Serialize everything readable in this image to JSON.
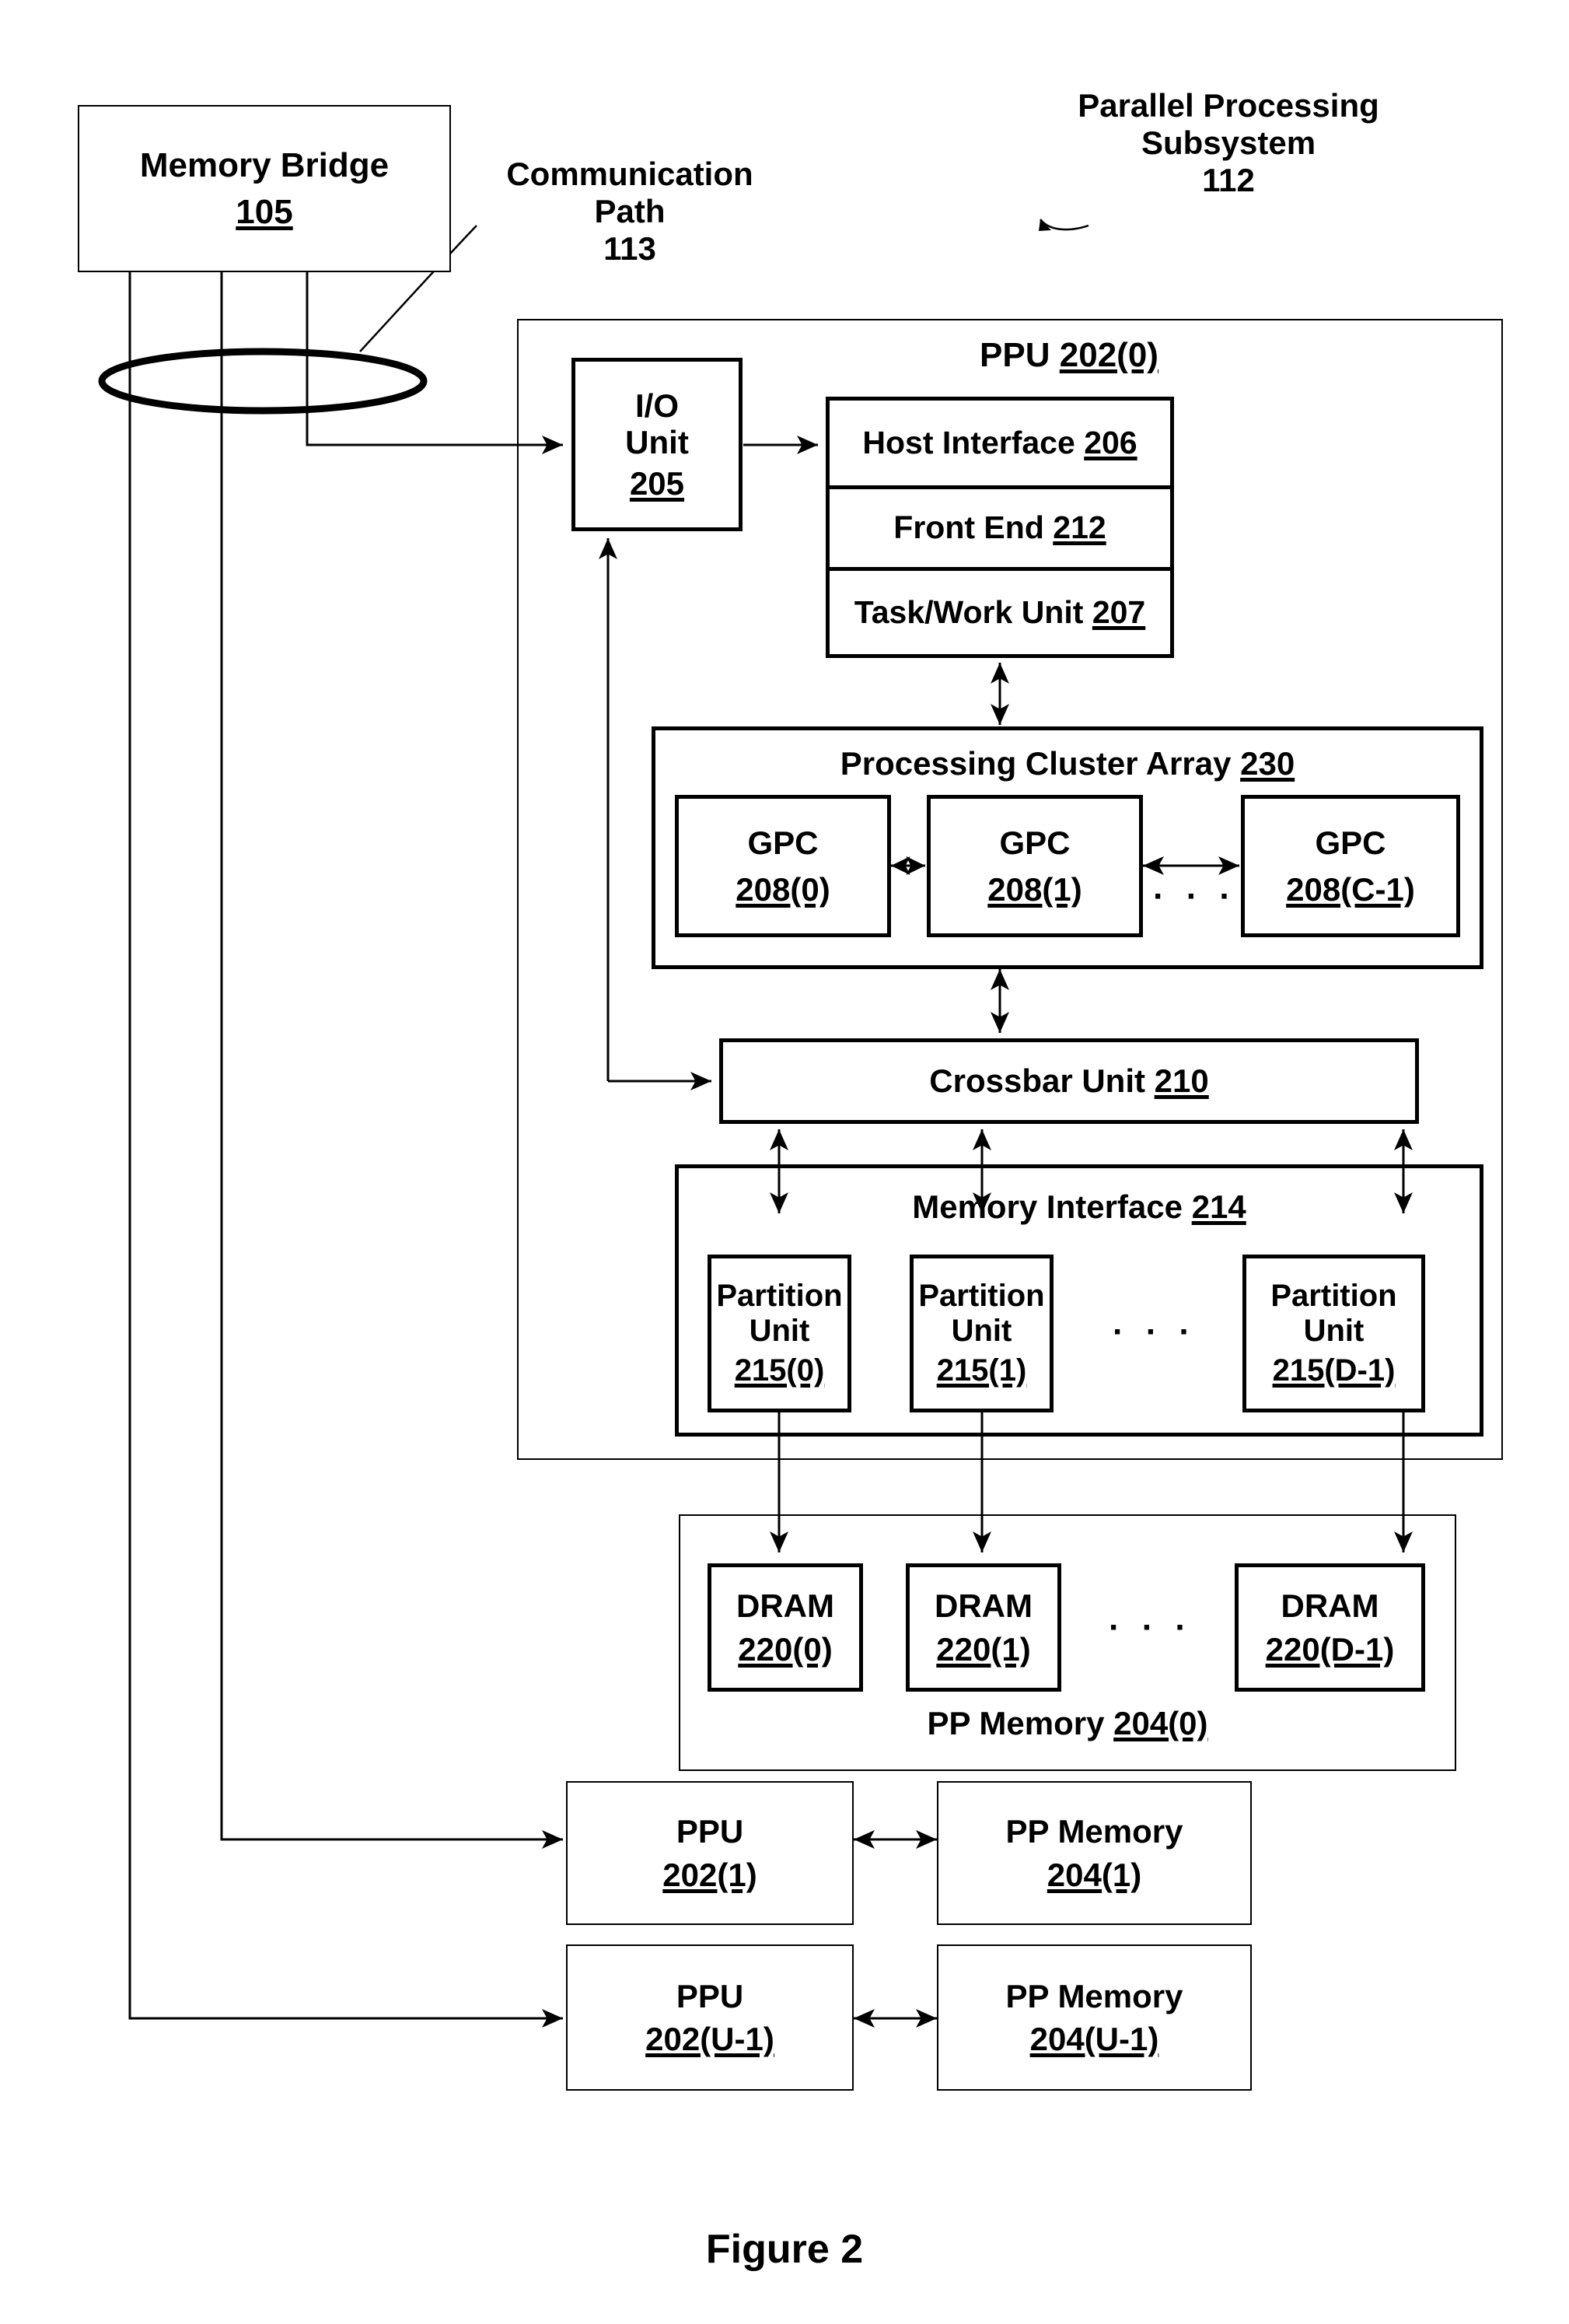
{
  "figure": {
    "caption": "Figure 2"
  },
  "annotations": {
    "communication_path": {
      "line1": "Communication",
      "line2": "Path",
      "ref": "113"
    },
    "parallel_processing_subsystem": {
      "line1": "Parallel Processing",
      "line2": "Subsystem",
      "ref": "112"
    }
  },
  "memory_bridge": {
    "label": "Memory Bridge",
    "ref": "105"
  },
  "ppu0": {
    "title_label": "PPU",
    "title_ref": "202(0)",
    "io_unit": {
      "line1": "I/O",
      "line2": "Unit",
      "ref": "205"
    },
    "stack": [
      {
        "label": "Host Interface",
        "ref": "206"
      },
      {
        "label": "Front End",
        "ref": "212"
      },
      {
        "label": "Task/Work Unit",
        "ref": "207"
      }
    ],
    "processing_cluster_array": {
      "label": "Processing Cluster Array",
      "ref": "230",
      "ellipsis": "· · ·",
      "gpcs": [
        {
          "label": "GPC",
          "ref": "208(0)"
        },
        {
          "label": "GPC",
          "ref": "208(1)"
        },
        {
          "label": "GPC",
          "ref": "208(C-1)"
        }
      ]
    },
    "crossbar_unit": {
      "label": "Crossbar Unit",
      "ref": "210"
    },
    "memory_interface": {
      "label": "Memory Interface",
      "ref": "214",
      "ellipsis": "· · ·",
      "partition_units": [
        {
          "line1": "Partition",
          "line2": "Unit",
          "ref": "215(0)"
        },
        {
          "line1": "Partition",
          "line2": "Unit",
          "ref": "215(1)"
        },
        {
          "line1": "Partition",
          "line2": "Unit",
          "ref": "215(D-1)"
        }
      ]
    }
  },
  "pp_memory0": {
    "label": "PP Memory",
    "ref": "204(0)",
    "ellipsis": "· · ·",
    "drams": [
      {
        "label": "DRAM",
        "ref": "220(0)"
      },
      {
        "label": "DRAM",
        "ref": "220(1)"
      },
      {
        "label": "DRAM",
        "ref": "220(D-1)"
      }
    ]
  },
  "additional_units": {
    "vertical_ellipsis": ".\n.\n.",
    "rows": [
      {
        "ppu": {
          "label": "PPU",
          "ref": "202(1)"
        },
        "memory": {
          "label": "PP Memory",
          "ref": "204(1)"
        }
      },
      {
        "ppu": {
          "label": "PPU",
          "ref": "202(U-1)"
        },
        "memory": {
          "label": "PP Memory",
          "ref": "204(U-1)"
        }
      }
    ]
  }
}
